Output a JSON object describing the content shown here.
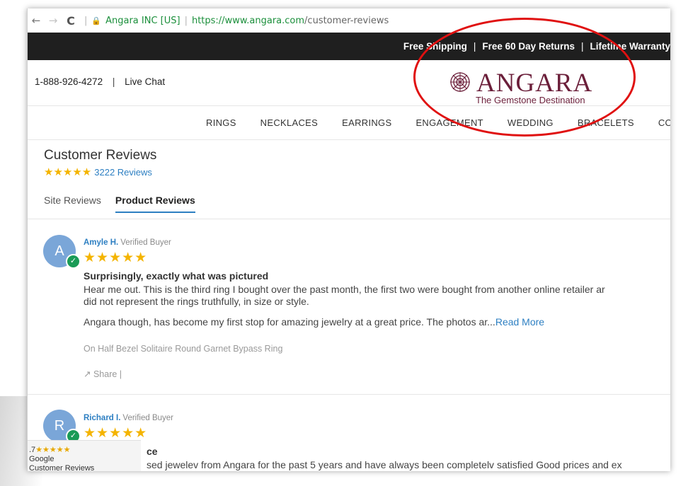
{
  "browser": {
    "secure_label": "Angara INC [US]",
    "url_host": "https://www.angara.com",
    "url_path": "/customer-reviews"
  },
  "promo": {
    "items": [
      "Free Shipping",
      "Free 60 Day Returns",
      "Lifetime Warranty"
    ]
  },
  "header": {
    "phone": "1-888-926-4272",
    "live_chat": "Live Chat",
    "logo_word": "ANGARA",
    "logo_tagline": "The Gemstone Destination"
  },
  "nav": {
    "items": [
      "RINGS",
      "NECKLACES",
      "EARRINGS",
      "ENGAGEMENT",
      "WEDDING",
      "BRACELETS",
      "COLI"
    ]
  },
  "page": {
    "title": "Customer Reviews",
    "overall_stars": "★★★★★",
    "review_count": "3222 Reviews",
    "tabs": [
      "Site Reviews",
      "Product Reviews"
    ]
  },
  "reviews": [
    {
      "initial": "A",
      "name": "Amyle H.",
      "badge": "Verified Buyer",
      "stars": "★★★★★",
      "title": "Surprisingly, exactly what was pictured",
      "body_line1": "Hear me out. This is the third ring I bought over the past month, the first two were bought from another online retailer ar",
      "body_line2": "did not represent the rings truthfully, in size or style.",
      "body_line3": "Angara though, has become my first stop for amazing jewelry at a great price. The photos ar...",
      "read_more": "Read More",
      "product": "On Half Bezel Solitaire Round Garnet Bypass Ring",
      "share": "Share |"
    },
    {
      "initial": "R",
      "name": "Richard I.",
      "badge": "Verified Buyer",
      "stars": "★★★★★",
      "title_partial": "ce",
      "body_partial": "sed jewelev from Angara for the past 5 years and have always been completelv satisfied Good prices and ex"
    }
  ],
  "google_badge": {
    "rating": ".7",
    "stars": "★★★★★",
    "line1": "Google",
    "line2": "Customer Reviews"
  },
  "colors": {
    "accent": "#2d7fc2",
    "star": "#f4b400",
    "brand": "#6b1f3a",
    "annotation": "#e01010"
  }
}
